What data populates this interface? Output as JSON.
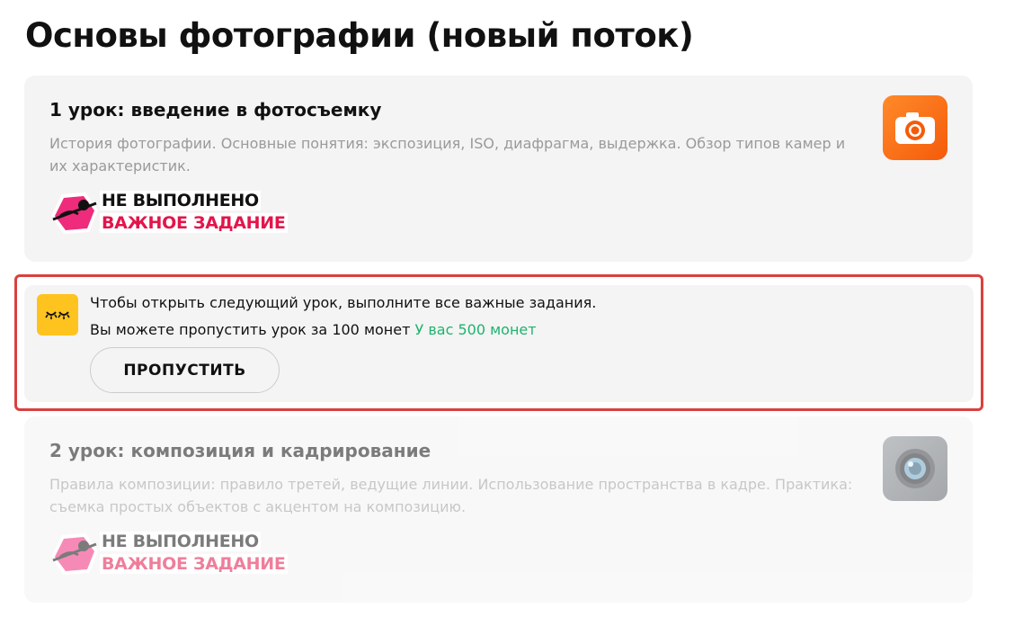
{
  "page": {
    "title": "Основы фотографии (новый поток)"
  },
  "lessons": [
    {
      "title": "1 урок: введение в фотосъемку",
      "description": "История фотографии. Основные понятия: экспозиция, ISO, диафрагма, выдержка. Обзор типов камер и их характеристик.",
      "icon": "camera-icon",
      "status_line1": "НЕ ВЫПОЛНЕНО",
      "status_line2": "ВАЖНОЕ ЗАДАНИЕ"
    },
    {
      "title": "2 урок: композиция и кадрирование",
      "description": "Правила композиции: правило третей, ведущие линии. Использование пространства в кадре. Практика: съемка простых объектов с акцентом на композицию.",
      "icon": "camera-lens-icon",
      "status_line1": "НЕ ВЫПОЛНЕНО",
      "status_line2": "ВАЖНОЕ ЗАДАНИЕ"
    }
  ],
  "lock_notice": {
    "message": "Чтобы открыть следующий урок, выполните все важные задания.",
    "skip_offer": "Вы можете пропустить урок за 100 монет",
    "balance": "У вас 500 монет",
    "skip_button_label": "ПРОПУСТИТЬ",
    "icon": "closed-eyes-icon"
  },
  "colors": {
    "accent_pink": "#e3154b",
    "coins_green": "#1eb36e",
    "highlight_red": "#d9403f",
    "lock_yellow": "#ffc31f"
  }
}
